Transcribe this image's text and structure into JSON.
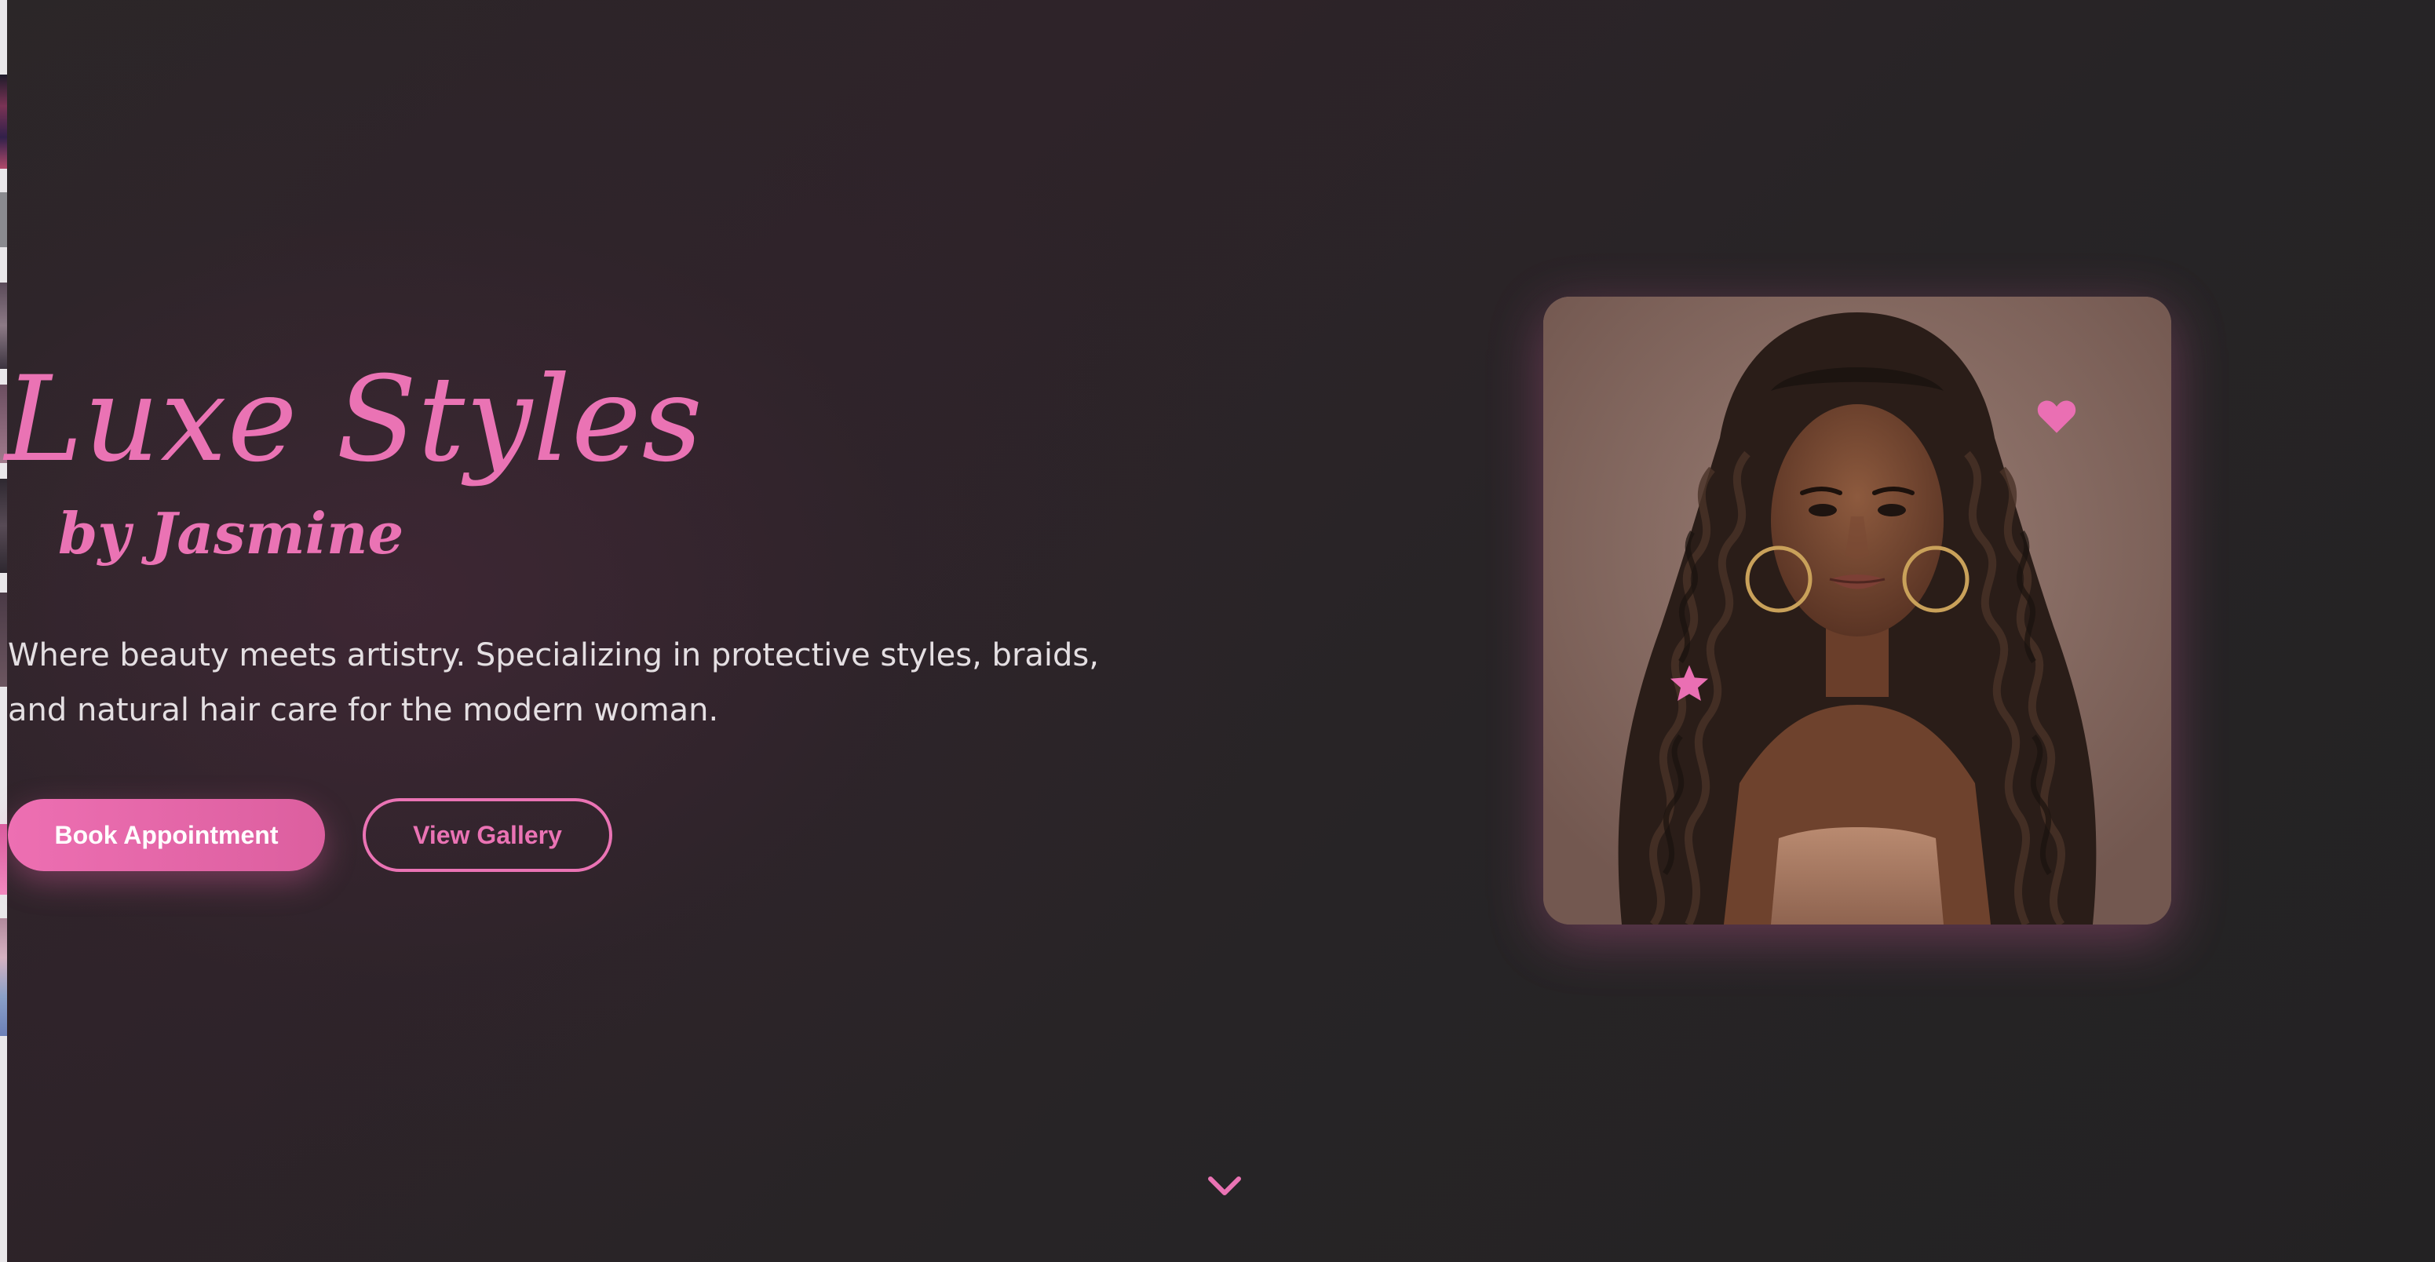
{
  "brand": {
    "title": "Luxe Styles",
    "subtitle": "by Jasmine"
  },
  "hero": {
    "description": "Where beauty meets artistry. Specializing in protective styles, braids, and natural hair care for the modern woman.",
    "primary_button": "Book Appointment",
    "secondary_button": "View Gallery"
  },
  "icons": {
    "heart": "heart-icon",
    "star": "star-icon",
    "scroll": "chevron-down-icon"
  },
  "colors": {
    "accent": "#ea73b4",
    "background": "#262426",
    "text": "#e4dfe2",
    "photo_background": "#8c7169"
  }
}
